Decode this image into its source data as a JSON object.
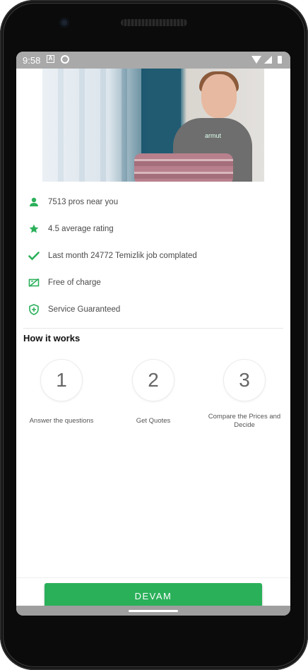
{
  "status_bar": {
    "time": "9:58",
    "icons": [
      "a-notification-icon",
      "sync-icon",
      "wifi-icon",
      "signal-icon",
      "battery-icon"
    ]
  },
  "hero": {
    "brand_text": "armut"
  },
  "features": [
    {
      "icon": "person-icon",
      "label": "7513 pros near you"
    },
    {
      "icon": "star-icon",
      "label": "4.5 average rating"
    },
    {
      "icon": "check-icon",
      "label": "Last month 24772 Temizlik job complated"
    },
    {
      "icon": "money-off-icon",
      "label": "Free of charge"
    },
    {
      "icon": "shield-icon",
      "label": "Service Guaranteed"
    }
  ],
  "how_it_works": {
    "title": "How it works",
    "steps": [
      {
        "number": "1",
        "label": "Answer the questions"
      },
      {
        "number": "2",
        "label": "Get Quotes"
      },
      {
        "number": "3",
        "label": "Compare the Prices and Decide"
      }
    ]
  },
  "cta": {
    "label": "DEVAM"
  },
  "colors": {
    "accent": "#2bb05a",
    "icon_green": "#2bb05a",
    "text": "#4a4a4a"
  }
}
